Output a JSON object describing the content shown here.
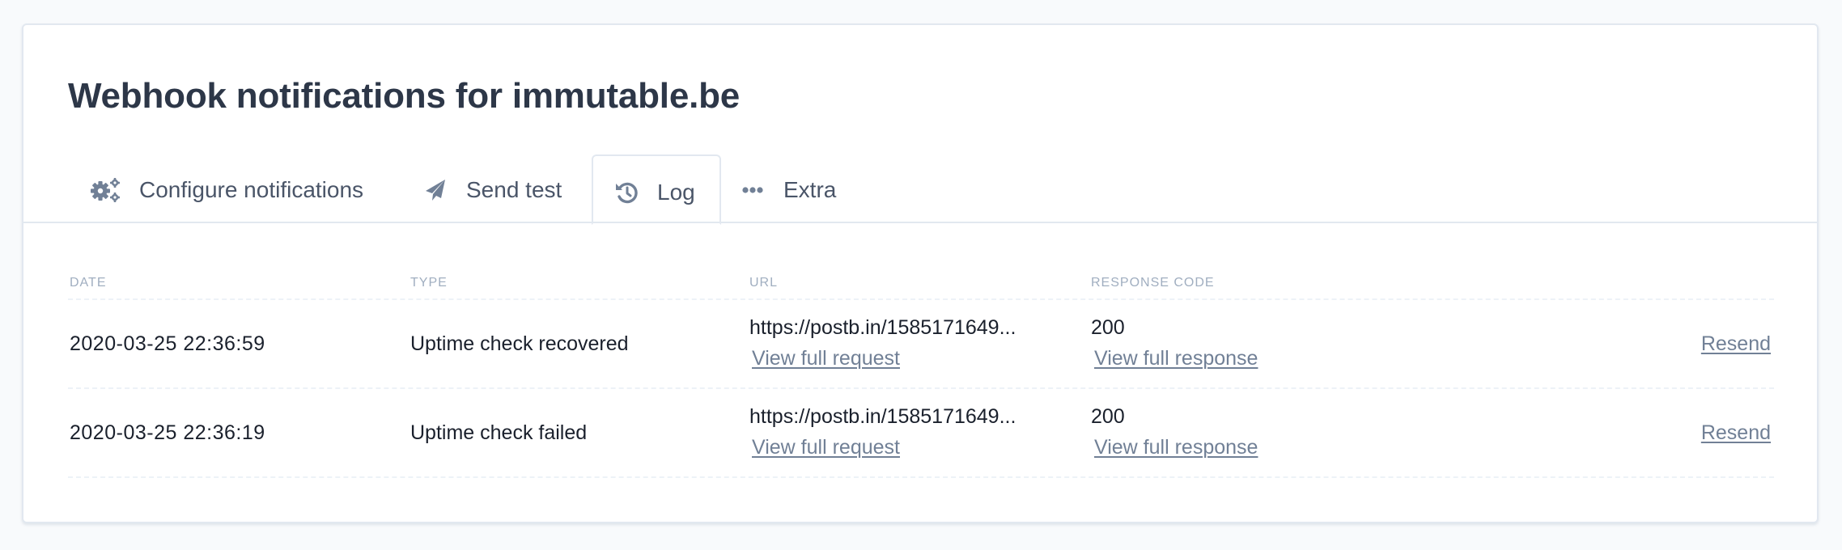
{
  "page": {
    "title": "Webhook notifications for immutable.be"
  },
  "tabs": [
    {
      "id": "configure",
      "label": "Configure notifications",
      "icon": "cogs-icon",
      "active": false
    },
    {
      "id": "send-test",
      "label": "Send test",
      "icon": "paper-plane-icon",
      "active": false
    },
    {
      "id": "log",
      "label": "Log",
      "icon": "history-icon",
      "active": true
    },
    {
      "id": "extra",
      "label": "Extra",
      "icon": "ellipsis-icon",
      "active": false
    }
  ],
  "table": {
    "headers": {
      "date": "Date",
      "type": "Type",
      "url": "URL",
      "response_code": "Response code"
    },
    "rows": [
      {
        "date": "2020-03-25 22:36:59",
        "type": "Uptime check recovered",
        "url": "https://postb.in/1585171649...",
        "view_request": "View full request",
        "response_code": "200",
        "view_response": "View full response",
        "resend": "Resend"
      },
      {
        "date": "2020-03-25 22:36:19",
        "type": "Uptime check failed",
        "url": "https://postb.in/1585171649...",
        "view_request": "View full request",
        "response_code": "200",
        "view_response": "View full response",
        "resend": "Resend"
      }
    ]
  },
  "colors": {
    "title": "#2d3748",
    "tab_text": "#4a5568",
    "icon": "#718096",
    "header_text": "#a0aec0",
    "link": "#718096",
    "border": "#e2e8f0"
  }
}
